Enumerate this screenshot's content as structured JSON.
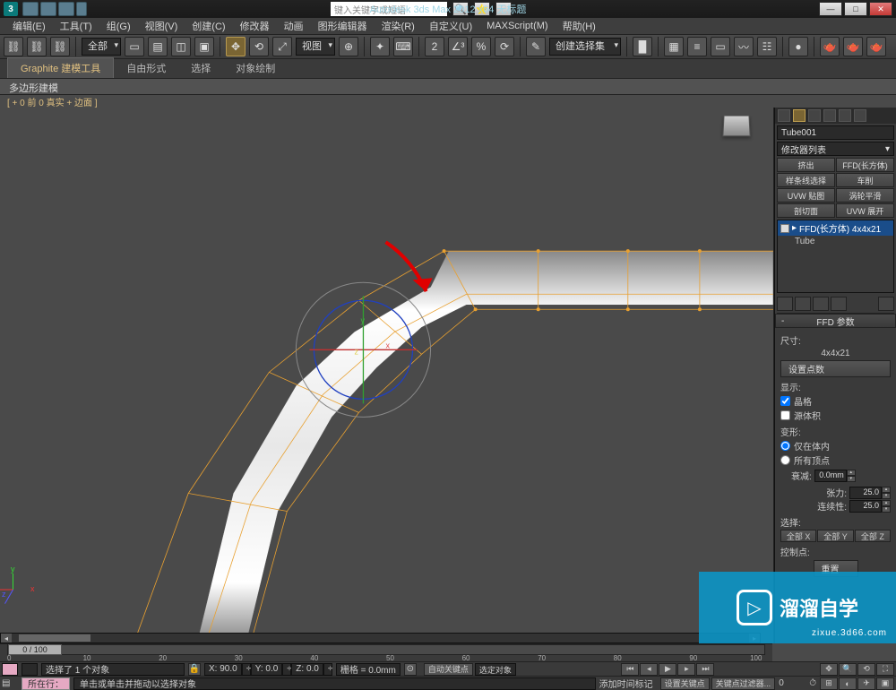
{
  "title": "Autodesk 3ds Max 2012 x64   无标题",
  "searchPlaceholder": "键入关键字或短语",
  "menus": [
    "编辑(E)",
    "工具(T)",
    "组(G)",
    "视图(V)",
    "创建(C)",
    "修改器",
    "动画",
    "图形编辑器",
    "渲染(R)",
    "自定义(U)",
    "MAXScript(M)",
    "帮助(H)"
  ],
  "toolbar": {
    "selFilter": "全部",
    "viewLabel": "视图",
    "createSel": "创建选择集"
  },
  "ribbon": {
    "tabs": [
      "Graphite 建模工具",
      "自由形式",
      "选择",
      "对象绘制"
    ],
    "sub": "多边形建模"
  },
  "viewportLabel": "[ + 0 前 0 真实 + 边面 ]",
  "side": {
    "objName": "Tube001",
    "modList": "修改器列表",
    "btns": [
      "挤出",
      "FFD(长方体)",
      "样条线选择",
      "车削",
      "UVW 贴图",
      "涡轮平滑",
      "剖切面",
      "UVW 展开"
    ],
    "stack": [
      {
        "label": "FFD(长方体) 4x4x21",
        "sel": true
      },
      {
        "label": "Tube",
        "sel": false
      }
    ],
    "ffd": {
      "header": "FFD 参数",
      "dimLabel": "尺寸:",
      "dimValue": "4x4x21",
      "setPoints": "设置点数",
      "displayLabel": "显示:",
      "chkLattice": "晶格",
      "chkSource": "源体积",
      "deformLabel": "变形:",
      "radInside": "仅在体内",
      "radAll": "所有顶点",
      "falloffLabel": "衰减:",
      "falloffVal": "0.0mm",
      "tensionLabel": "张力:",
      "tensionVal": "25.0",
      "continuityLabel": "连续性:",
      "continuityVal": "25.0",
      "selLabel": "选择:",
      "selBtns": [
        "全部 X",
        "全部 Y",
        "全部 Z"
      ],
      "ctrlLabel": "控制点:",
      "ctrlBtn": "重置"
    }
  },
  "timeline": {
    "frame": "0 / 100",
    "ticks": [
      "0",
      "10",
      "20",
      "30",
      "40",
      "50",
      "60",
      "70",
      "80",
      "90",
      "100"
    ]
  },
  "status": {
    "selText": "选择了 1 个对象",
    "hint": "单击或单击并拖动以选择对象",
    "x": "X: 90.0",
    "y": "Y: 0.0",
    "z": "Z: 0.0",
    "grid": "栅格 = 0.0mm",
    "autoKey": "自动关键点",
    "selLock": "选定对象",
    "addTime": "添加时间标记",
    "setKey": "设置关键点",
    "keyFilter": "关键点过滤器...",
    "nowAt": "所在行："
  },
  "watermark": {
    "brand": "溜溜自学",
    "url": "zixue.3d66.com"
  }
}
